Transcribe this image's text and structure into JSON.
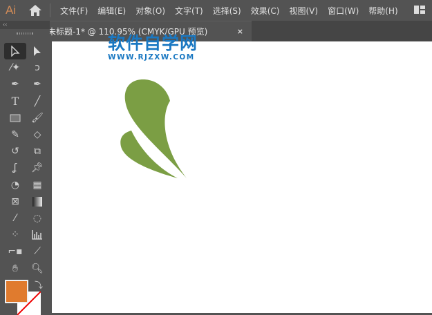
{
  "app": {
    "logo": "Ai",
    "home_icon": "home-icon",
    "layout_icon": "workspace-layout-icon"
  },
  "menu": [
    "文件(F)",
    "编辑(E)",
    "对象(O)",
    "文字(T)",
    "选择(S)",
    "效果(C)",
    "视图(V)",
    "窗口(W)",
    "帮助(H)"
  ],
  "panel": {
    "collapse": "‹‹"
  },
  "document_tab": {
    "title": "未标题-1* @ 110.95% (CMYK/GPU 预览)",
    "close": "×"
  },
  "watermark": {
    "title": "软件自学网",
    "url": "WWW.RJZXW.COM"
  },
  "colors": {
    "fill": "#e07b2e",
    "shape": "#7b9e44",
    "accent": "#1a78c2"
  },
  "tools": [
    "selection",
    "direct-selection",
    "magic-wand",
    "lasso",
    "pen",
    "curvature",
    "type",
    "line-segment",
    "rectangle",
    "paintbrush",
    "shaper",
    "eraser",
    "rotate",
    "scale",
    "warp",
    "puppet-warp",
    "shape-builder",
    "perspective-grid",
    "mesh",
    "gradient",
    "eyedropper",
    "blend",
    "symbol-sprayer",
    "column-graph",
    "artboard",
    "slice",
    "hand",
    "zoom"
  ]
}
